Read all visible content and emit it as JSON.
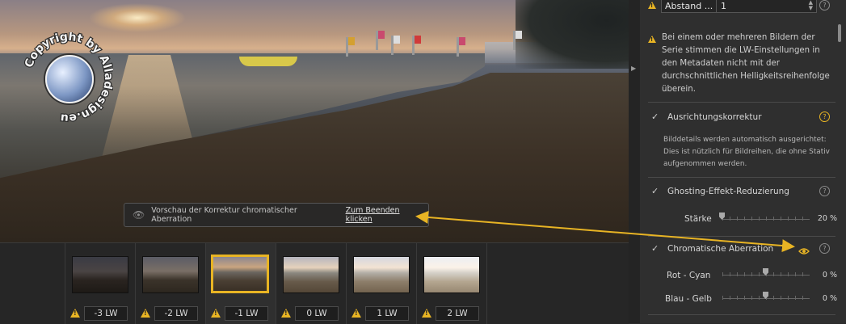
{
  "watermark": {
    "text": "Copyright by Alladesign.eu"
  },
  "preview_notice": {
    "text": "Vorschau der Korrektur chromatischer Aberration",
    "link": "Zum Beenden klicken",
    "icon": "eye-icon"
  },
  "filmstrip": {
    "thumbs": [
      {
        "lw": "-3 LW",
        "selected": false,
        "warning": true
      },
      {
        "lw": "-2 LW",
        "selected": false,
        "warning": true
      },
      {
        "lw": "-1 LW",
        "selected": true,
        "warning": true
      },
      {
        "lw": "0 LW",
        "selected": false,
        "warning": true
      },
      {
        "lw": "1 LW",
        "selected": false,
        "warning": true
      },
      {
        "lw": "2 LW",
        "selected": false,
        "warning": true
      }
    ]
  },
  "panel": {
    "abstand": {
      "label": "Abstand ...",
      "value": "1"
    },
    "warning_text": "Bei einem oder mehreren Bildern der Serie stimmen die LW-Einstellungen in den Metadaten nicht mit der durchschnittlichen Helligkeitsreihenfolge überein.",
    "ausrichtung": {
      "label": "Ausrichtungskorrektur",
      "checked": true,
      "description": "Bilddetails werden automatisch ausgerichtet: Dies ist nützlich für Bildreihen, die ohne Stativ aufgenommen werden."
    },
    "ghosting": {
      "label": "Ghosting-Effekt-Reduzierung",
      "checked": true,
      "strength_label": "Stärke",
      "strength_value": "20 %"
    },
    "chromatic": {
      "label": "Chromatische Aberration",
      "checked": true,
      "rot_cyan_label": "Rot - Cyan",
      "rot_cyan_value": "0 %",
      "blau_gelb_label": "Blau - Gelb",
      "blau_gelb_value": "0 %"
    }
  },
  "colors": {
    "accent": "#e8b424",
    "panel_bg": "#2f2f2f",
    "filmstrip_bg": "#262626"
  }
}
